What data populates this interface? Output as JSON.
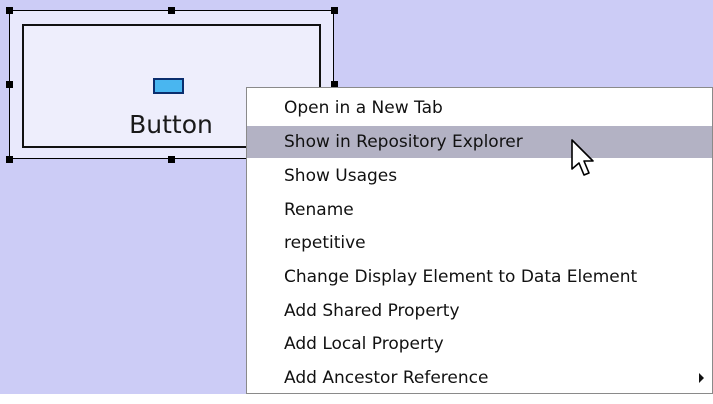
{
  "widget": {
    "label": "Button",
    "icon": "button-icon"
  },
  "context_menu": {
    "items": [
      {
        "label": "Open in a New Tab",
        "highlighted": false,
        "submenu": false
      },
      {
        "label": "Show in Repository Explorer",
        "highlighted": true,
        "submenu": false
      },
      {
        "label": "Show Usages",
        "highlighted": false,
        "submenu": false
      },
      {
        "label": "Rename",
        "highlighted": false,
        "submenu": false
      },
      {
        "label": "repetitive",
        "highlighted": false,
        "submenu": false
      },
      {
        "label": "Change Display Element to Data Element",
        "highlighted": false,
        "submenu": false
      },
      {
        "label": "Add Shared Property",
        "highlighted": false,
        "submenu": false
      },
      {
        "label": "Add Local Property",
        "highlighted": false,
        "submenu": false
      },
      {
        "label": "Add Ancestor Reference",
        "highlighted": false,
        "submenu": true
      }
    ]
  },
  "colors": {
    "canvas_background": "#ccccf6",
    "menu_highlight": "#b3b2c4",
    "widget_icon_fill": "#49b6f0"
  },
  "icons": [
    "button-icon",
    "mouse-pointer-icon",
    "submenu-arrow-icon"
  ]
}
